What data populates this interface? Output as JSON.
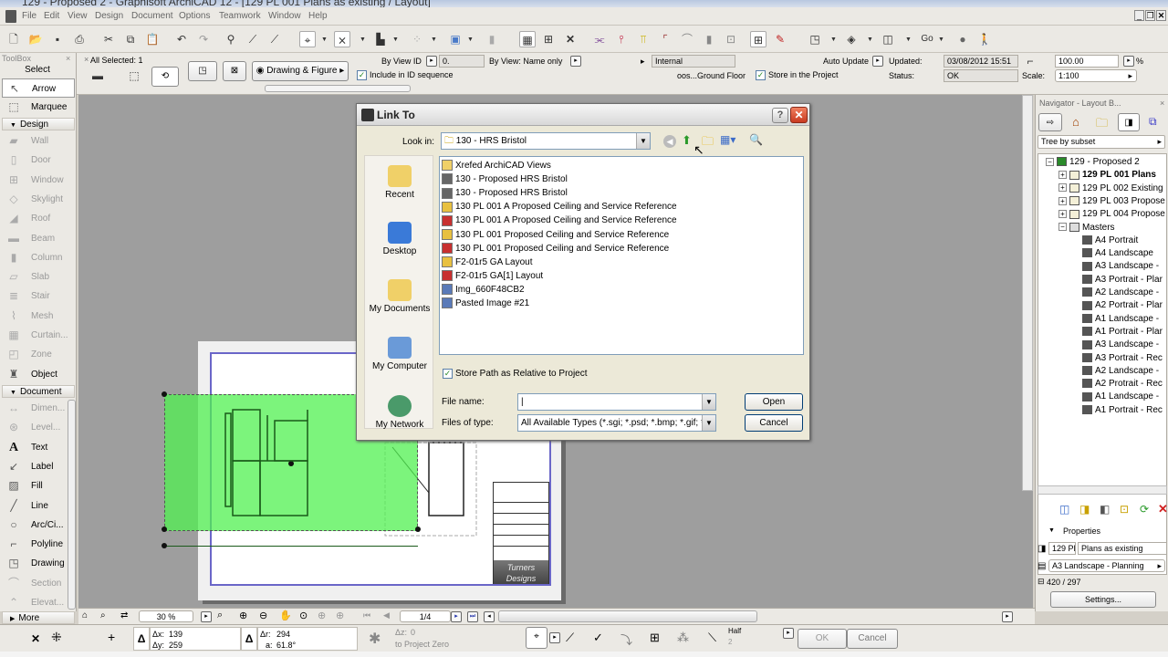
{
  "window": {
    "title": "129 - Proposed 2 - Graphisoft ArchiCAD 12 - [129 PL 001 Plans as existing / Layout]"
  },
  "menu": [
    "File",
    "Edit",
    "View",
    "Design",
    "Document",
    "Options",
    "Teamwork",
    "Window",
    "Help"
  ],
  "toolbar": {
    "icons": [
      "new-icon",
      "open-icon",
      "save-icon",
      "print-icon",
      "cut-icon",
      "copy-icon",
      "paste-icon",
      "undo-icon",
      "redo-icon",
      "find-select-icon",
      "eyedropper-icon",
      "syringe-icon",
      "gravity-icon",
      "suspend-groups-icon",
      "trace-icon",
      "grid-snap-icon",
      "layers-icon",
      "lock-icon",
      "magic-wand-icon",
      "elevation-icon",
      "close-icon",
      "split-icon",
      "adjust-icon",
      "intersect-icon",
      "fillet-icon",
      "offset-icon",
      "explode-icon",
      "resize-icon",
      "drag-icon",
      "paint-icon",
      "view-plan-icon",
      "view-3d-icon",
      "view-layout-icon",
      "walk-icon",
      "person-icon"
    ],
    "go_label": "Go"
  },
  "infobox": {
    "all_selected": "All Selected: 1",
    "drawing_figure": "Drawing & Figure",
    "by_view_id": "By View ID",
    "view_id_value": "0.",
    "include_id_sequence": "Include in ID sequence",
    "by_view_name": "By View: Name only",
    "internal": "Internal",
    "source": "oos...Ground Floor",
    "auto_update": "Auto Update",
    "store_in_project": "Store in the Project",
    "updated_label": "Updated:",
    "updated_value": "03/08/2012 15:51",
    "status_label": "Status:",
    "status_value": "OK",
    "zoom_value": "100.00",
    "percent": "%",
    "scale_label": "Scale:",
    "scale_value": "1:100"
  },
  "toolbox": {
    "header": "ToolBox",
    "select": "Select",
    "select_tools": [
      {
        "label": "Arrow",
        "icon": "arrow-icon"
      },
      {
        "label": "Marquee",
        "icon": "marquee-icon"
      }
    ],
    "design_header": "Design",
    "design_tools": [
      {
        "label": "Wall",
        "icon": "wall-icon"
      },
      {
        "label": "Door",
        "icon": "door-icon"
      },
      {
        "label": "Window",
        "icon": "window-icon"
      },
      {
        "label": "Skylight",
        "icon": "skylight-icon"
      },
      {
        "label": "Roof",
        "icon": "roof-icon"
      },
      {
        "label": "Beam",
        "icon": "beam-icon"
      },
      {
        "label": "Column",
        "icon": "column-icon"
      },
      {
        "label": "Slab",
        "icon": "slab-icon"
      },
      {
        "label": "Stair",
        "icon": "stair-icon"
      },
      {
        "label": "Mesh",
        "icon": "mesh-icon"
      },
      {
        "label": "Curtain...",
        "icon": "curtain-wall-icon"
      },
      {
        "label": "Zone",
        "icon": "zone-icon"
      },
      {
        "label": "Object",
        "icon": "object-icon"
      }
    ],
    "document_header": "Document",
    "document_tools": [
      {
        "label": "Dimen...",
        "icon": "dimension-icon"
      },
      {
        "label": "Level...",
        "icon": "level-icon"
      },
      {
        "label": "Text",
        "icon": "text-icon"
      },
      {
        "label": "Label",
        "icon": "label-icon"
      },
      {
        "label": "Fill",
        "icon": "fill-icon"
      },
      {
        "label": "Line",
        "icon": "line-icon"
      },
      {
        "label": "Arc/Ci...",
        "icon": "arc-icon"
      },
      {
        "label": "Polyline",
        "icon": "polyline-icon"
      },
      {
        "label": "Drawing",
        "icon": "drawing-icon"
      },
      {
        "label": "Section",
        "icon": "section-icon"
      },
      {
        "label": "Elevat...",
        "icon": "elevation-icon"
      }
    ],
    "more": "More"
  },
  "dialog": {
    "title": "Link To",
    "look_in_label": "Look in:",
    "look_in_value": "130 - HRS Bristol",
    "places": [
      "Recent",
      "Desktop",
      "My Documents",
      "My Computer",
      "My Network"
    ],
    "files": [
      {
        "name": "Xrefed ArchiCAD Views",
        "type": "folder"
      },
      {
        "name": "130 - Proposed HRS Bristol",
        "type": "pln"
      },
      {
        "name": "130 - Proposed HRS Bristol",
        "type": "pln"
      },
      {
        "name": "130 PL 001 A Proposed Ceiling and Service Reference",
        "type": "dwg"
      },
      {
        "name": "130 PL 001 A Proposed Ceiling and Service Reference",
        "type": "pdf"
      },
      {
        "name": "130 PL 001 Proposed Ceiling and Service Reference",
        "type": "dwg"
      },
      {
        "name": "130 PL 001 Proposed Ceiling and Service Reference",
        "type": "pdf"
      },
      {
        "name": "F2-01r5 GA Layout",
        "type": "dwg"
      },
      {
        "name": "F2-01r5 GA[1] Layout",
        "type": "pdf"
      },
      {
        "name": "Img_660F48CB2",
        "type": "image"
      },
      {
        "name": "Pasted Image #21",
        "type": "image"
      }
    ],
    "store_relative": "Store Path as Relative to Project",
    "file_name_label": "File name:",
    "file_name_value": "",
    "files_of_type_label": "Files of type:",
    "files_of_type_value": "All Available Types (*.sgi; *.psd; *.bmp; *.gif; *.jp",
    "open": "Open",
    "cancel": "Cancel"
  },
  "navigator": {
    "title": "Navigator - Layout B...",
    "tree_mode": "Tree by subset",
    "root": "129 - Proposed 2",
    "subsets": [
      "129 PL 001 Plans",
      "129 PL 002 Existing",
      "129 PL 003 Propose",
      "129 PL 004 Propose"
    ],
    "masters_label": "Masters",
    "masters": [
      "A4 Portrait",
      "A4 Landscape",
      "A3 Landscape -",
      "A3 Portrait - Plar",
      "A2 Landscape -",
      "A2 Portrait - Plar",
      "A1 Landscape -",
      "A1 Portrait - Plar",
      "A3 Landscape -",
      "A3 Portrait - Rec",
      "A2 Landscape -",
      "A2 Protrait - Rec",
      "A1 Landscape -",
      "A1 Portrait - Rec"
    ],
    "properties_label": "Properties",
    "prop_id": "129 Pl",
    "prop_name": "Plans as existing",
    "prop_master": "A3 Landscape - Planning",
    "prop_size": "420 / 297",
    "settings": "Settings..."
  },
  "canvas": {
    "zoom": "30 %",
    "page": "1/4",
    "logo_line1": "Turners",
    "logo_line2": "Designs"
  },
  "coords": {
    "dx_label": "Δx:",
    "dx": "139",
    "dy_label": "Δy:",
    "dy": "259",
    "dr_label": "Δr:",
    "dr": "294",
    "angle_label": "a:",
    "angle": "61.8°",
    "dz_label": "Δz:",
    "dz": "0",
    "to_project_zero": "to Project Zero",
    "half": "Half",
    "half_value": "2",
    "ok": "OK",
    "cancel": "Cancel"
  }
}
